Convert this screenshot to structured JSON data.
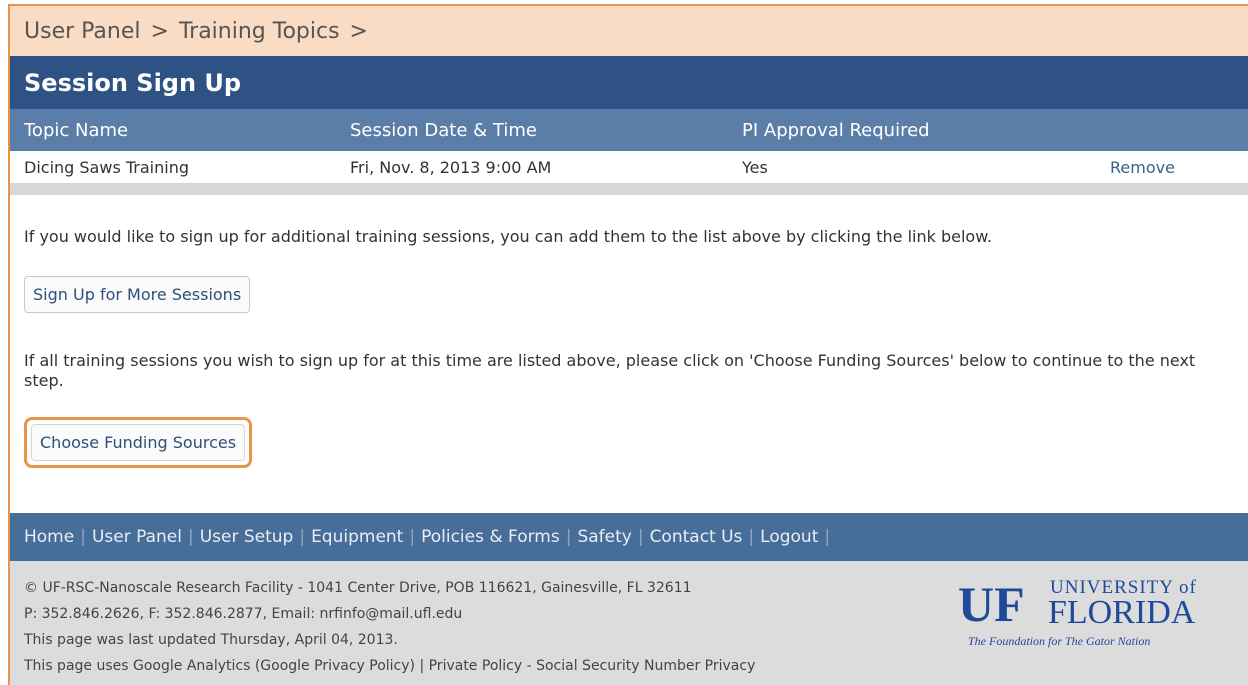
{
  "breadcrumb": {
    "item1": "User Panel",
    "sep1": ">",
    "item2": "Training Topics",
    "sep2": ">"
  },
  "page_title": "Session Sign Up",
  "table": {
    "headers": [
      "Topic Name",
      "Session Date & Time",
      "PI Approval Required"
    ],
    "rows": [
      {
        "topic": "Dicing Saws Training",
        "datetime": "Fri, Nov. 8, 2013 9:00 AM",
        "approval": "Yes",
        "action": "Remove"
      }
    ]
  },
  "content": {
    "para1": "If you would like to sign up for additional training sessions, you can add them to the list above by clicking the link below.",
    "signup_button": "Sign Up for More Sessions",
    "para2": "If all training sessions you wish to sign up for at this time are listed above, please click on 'Choose Funding Sources' below to continue to the next step.",
    "funding_button": "Choose Funding Sources"
  },
  "nav": {
    "items": [
      "Home",
      "User Panel",
      "User Setup",
      "Equipment",
      "Policies & Forms",
      "Safety",
      "Contact Us",
      "Logout"
    ],
    "separator": "|"
  },
  "footer": {
    "line1": "© UF-RSC-Nanoscale Research Facility - 1041 Center Drive, POB 116621, Gainesville, FL 32611",
    "line2": "P: 352.846.2626, F: 352.846.2877, Email: nrfinfo@mail.ufl.edu",
    "line3": "This page was last updated Thursday, April 04, 2013.",
    "line4": "This page uses Google Analytics (Google Privacy Policy) | Private Policy - Social Security Number Privacy",
    "logo": {
      "mark": "UF",
      "name1": "UNIVERSITY of",
      "name2": "FLORIDA",
      "tagline": "The Foundation for The Gator Nation"
    }
  },
  "colors": {
    "accent_orange": "#e8944a",
    "header_blue": "#2e5284",
    "subheader_blue": "#5b7ea9",
    "nav_blue": "#476d99",
    "uf_blue": "#1f4a99",
    "uf_orange": "#e8772e"
  }
}
